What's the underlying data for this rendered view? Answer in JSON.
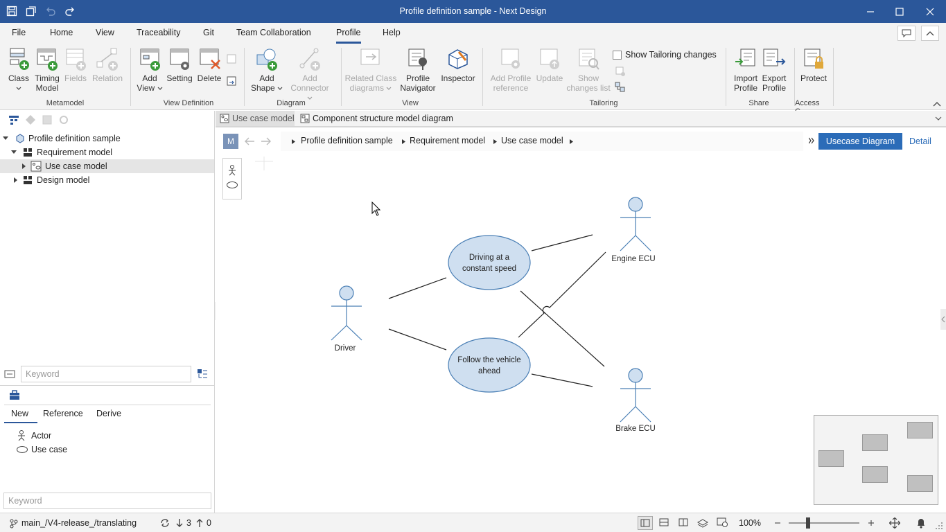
{
  "window": {
    "title": "Profile definition sample - Next Design"
  },
  "menu": {
    "tabs": [
      {
        "label": "File"
      },
      {
        "label": "Home"
      },
      {
        "label": "View"
      },
      {
        "label": "Traceability"
      },
      {
        "label": "Git"
      },
      {
        "label": "Team Collaboration"
      },
      {
        "label": "Profile"
      },
      {
        "label": "Help"
      }
    ],
    "active": "Profile"
  },
  "ribbon": {
    "groups": {
      "metamodel": "Metamodel",
      "view_definition": "View Definition",
      "diagram": "Diagram",
      "view": "View",
      "tailoring": "Tailoring",
      "share": "Share",
      "access": "Access C..."
    },
    "buttons": {
      "class": [
        "Class",
        ""
      ],
      "timing_model": [
        "Timing",
        "Model"
      ],
      "fields": [
        "Fields",
        ""
      ],
      "relation": [
        "Relation",
        ""
      ],
      "add_view": [
        "Add",
        "View"
      ],
      "setting": [
        "Setting",
        ""
      ],
      "delete": [
        "Delete",
        ""
      ],
      "add_shape": [
        "Add",
        "Shape"
      ],
      "add_connector": [
        "Add",
        "Connector"
      ],
      "related_class": [
        "Related Class",
        "diagrams"
      ],
      "profile_navigator": [
        "Profile",
        "Navigator"
      ],
      "inspector": [
        "Inspector",
        ""
      ],
      "add_profile_reference": [
        "Add Profile",
        "reference"
      ],
      "update": [
        "Update",
        ""
      ],
      "show_changes": [
        "Show",
        "changes list"
      ],
      "import_profile": [
        "Import",
        "Profile"
      ],
      "export_profile": [
        "Export",
        "Profile"
      ],
      "protect": [
        "Protect",
        ""
      ]
    },
    "show_tailoring_label": "Show Tailoring changes",
    "show_tailoring_checked": false
  },
  "tree": {
    "items": [
      {
        "label": "Profile definition sample"
      },
      {
        "label": "Requirement model"
      },
      {
        "label": "Use case model"
      },
      {
        "label": "Design model"
      }
    ]
  },
  "left_search": {
    "placeholder": "Keyword"
  },
  "palette": {
    "tabs": [
      {
        "label": "New"
      },
      {
        "label": "Reference"
      },
      {
        "label": "Derive"
      }
    ],
    "active_tab": "New",
    "items": [
      {
        "label": "Actor"
      },
      {
        "label": "Use case"
      }
    ],
    "search_placeholder": "Keyword"
  },
  "doc_tabs": [
    {
      "label": "Use case model"
    },
    {
      "label": "Component structure model diagram"
    }
  ],
  "breadcrumb": {
    "mode_letter": "M",
    "items": [
      "Profile definition sample",
      "Requirement model",
      "Use case model"
    ]
  },
  "view_controls": {
    "active_view": "Usecase Diagram",
    "detail": "Detail"
  },
  "diagram": {
    "actors": [
      {
        "name": "Driver"
      },
      {
        "name": "Engine ECU"
      },
      {
        "name": "Brake ECU"
      }
    ],
    "usecases": [
      {
        "lines": [
          "Driving at a",
          "constant speed"
        ]
      },
      {
        "lines": [
          "Follow the vehicle",
          "ahead"
        ]
      }
    ]
  },
  "statusbar": {
    "branch": "main_/V4-release_/translating",
    "incoming": "3",
    "outgoing": "0",
    "zoom": "100%"
  },
  "colors": {
    "accent": "#2b579a",
    "shape_fill": "#cfdff0",
    "shape_stroke": "#4a7fb5"
  }
}
